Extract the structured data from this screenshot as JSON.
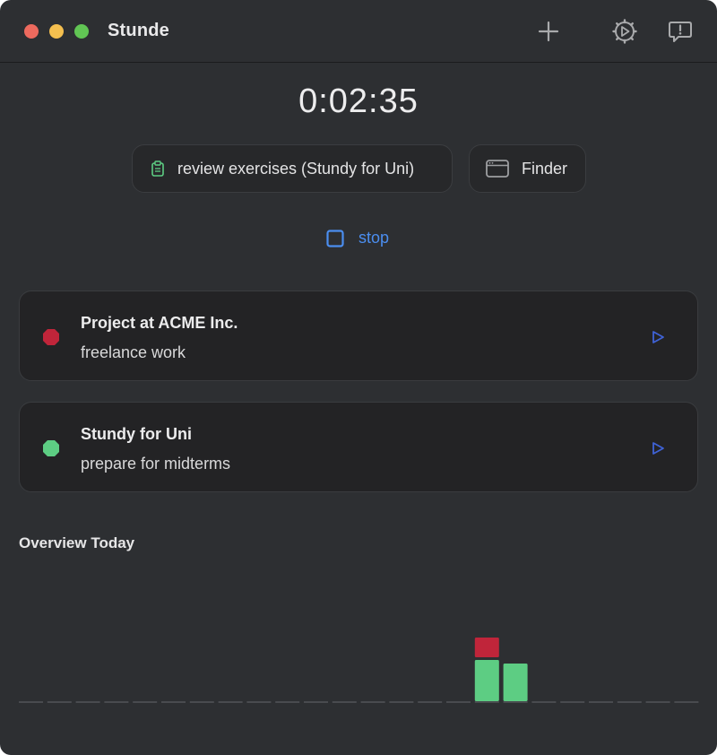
{
  "window": {
    "title": "Stunde",
    "traffic_colors": {
      "close": "#ed6a5e",
      "minimize": "#f4bf4f",
      "zoom": "#61c554"
    }
  },
  "toolbar": {
    "icons": [
      "plus-icon",
      "settings-gear-icon",
      "feedback-icon"
    ]
  },
  "timer": {
    "elapsed": "0:02:35"
  },
  "current": {
    "task_label": "review exercises (Stundy for Uni)",
    "task_icon": "clipboard-icon",
    "app_label": "Finder",
    "app_icon": "window-icon",
    "stop_label": "stop",
    "stop_icon": "square-stop-icon"
  },
  "projects": [
    {
      "name": "Project at ACME Inc.",
      "description": "freelance work",
      "color": "#c0253a"
    },
    {
      "name": "Stundy for Uni",
      "description": "prepare for midterms",
      "color": "#5dcd83"
    }
  ],
  "overview": {
    "title": "Overview Today"
  },
  "chart_data": {
    "type": "bar",
    "stacked": true,
    "slots": 24,
    "series": [
      {
        "color": "#5dcd83",
        "values": [
          0,
          0,
          0,
          0,
          0,
          0,
          0,
          0,
          0,
          0,
          0,
          0,
          0,
          0,
          0,
          0,
          46,
          42,
          0,
          0,
          0,
          0,
          0,
          0
        ]
      },
      {
        "color": "#c0253a",
        "values": [
          0,
          0,
          0,
          0,
          0,
          0,
          0,
          0,
          0,
          0,
          0,
          0,
          0,
          0,
          0,
          0,
          22,
          0,
          0,
          0,
          0,
          0,
          0,
          0
        ]
      }
    ],
    "baseline_color": "#494b4f",
    "grid": false,
    "legend": false
  },
  "colors": {
    "background": "#2d2f32",
    "card": "#232325",
    "accent_blue": "#4b8ef0",
    "text": "#ececed"
  }
}
